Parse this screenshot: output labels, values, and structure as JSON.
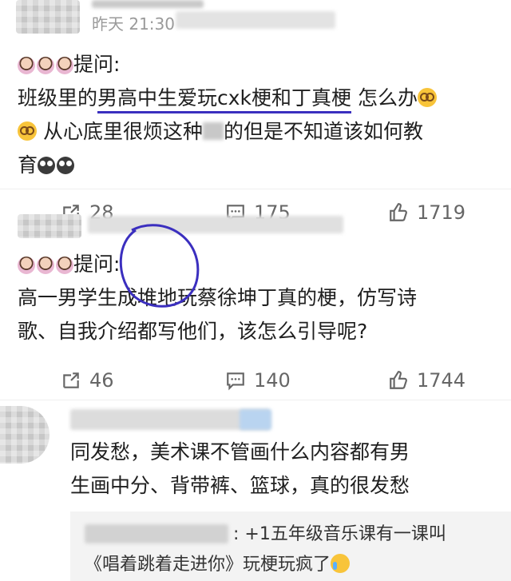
{
  "post1": {
    "timestamp": "昨天 21:30",
    "prefix": "提问:",
    "line1_a": "班级里的",
    "line1_b": "男高中生爱玩cxk梗和丁真梗",
    "line1_c": " 怎么办",
    "line2": " 从心底里很烦这种",
    "line2_b": "的但是不知道该如何教",
    "line3": "育",
    "shares": "28",
    "comments": "175",
    "likes": "1719"
  },
  "post2": {
    "prefix": "提问:",
    "line1": "高一男学生成堆地玩蔡徐坤丁真的梗，仿写诗",
    "line2": "歌、自我介绍都写他们，该怎么引导呢?",
    "shares": "46",
    "comments": "140",
    "likes": "1744"
  },
  "comment": {
    "line1": "同发愁，美术课不管画什么内容都有男",
    "line2": "生画中分、背带裤、篮球，真的很发愁"
  },
  "reply": {
    "line1": ": +1五年级音乐课有一课叫",
    "line2": "《唱着跳着走进你》玩梗玩疯了"
  },
  "colors": {
    "underline": "#3b2fbf",
    "circle": "#3b2fbf",
    "icon": "#666666"
  }
}
